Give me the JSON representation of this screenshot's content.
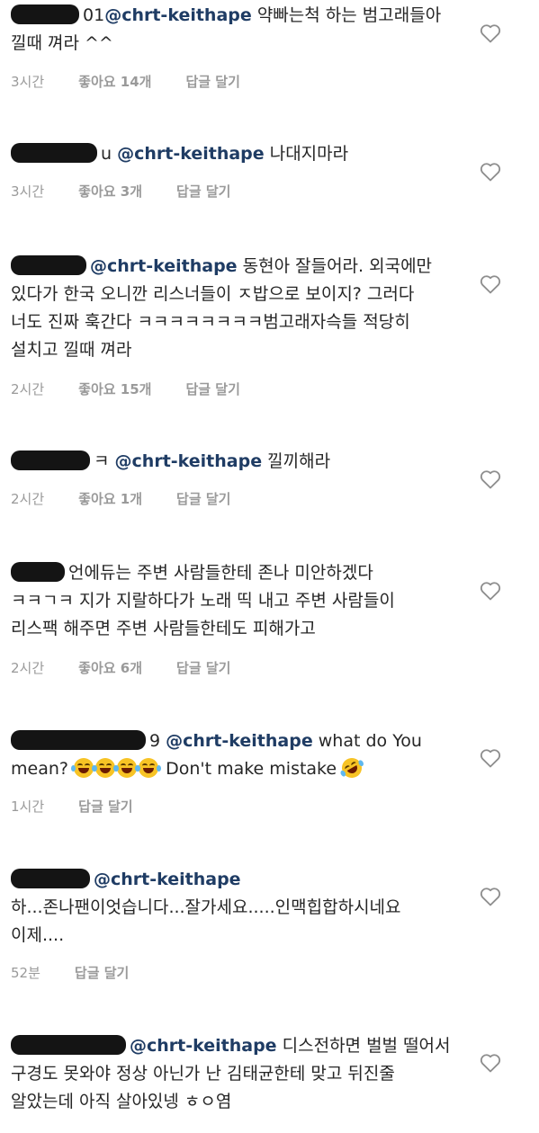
{
  "comments": [
    {
      "redacted_prefix": "01",
      "mention": "@chrt-keithape",
      "text_line1": "약빠는척 하는 범고래들아",
      "text_line2": "낄때 껴라 ^^",
      "time": "3시간",
      "likes": "좋아요 14개",
      "reply": "답글 달기"
    },
    {
      "redacted_prefix": "u",
      "mention": "@chrt-keithape",
      "text_line1": "나대지마라",
      "time": "3시간",
      "likes": "좋아요 3개",
      "reply": "답글 달기"
    },
    {
      "mention": "@chrt-keithape",
      "text_line1": "동현아 잘들어라. 외국에만",
      "text_line2": "있다가 한국 오니깐 리스너들이 ㅈ밥으로 보이지? 그러다",
      "text_line3": "너도 진짜 훅간다 ㅋㅋㅋㅋㅋㅋㅋㅋ범고래자슥들 적당히",
      "text_line4": "설치고 낄때 껴라",
      "time": "2시간",
      "likes": "좋아요 15개",
      "reply": "답글 달기"
    },
    {
      "redacted_prefix": "ㅋ",
      "mention": "@chrt-keithape",
      "text_line1": "낄끼해라",
      "time": "2시간",
      "likes": "좋아요 1개",
      "reply": "답글 달기"
    },
    {
      "text_line1": "언에듀는 주변 사람들한테 존나 미안하겠다",
      "text_line2": "ㅋㅋㄱㅋ 지가 지랄하다가 노래 띡 내고 주변 사람들이",
      "text_line3": "리스팩 해주면 주변 사람들한테도 피해가고",
      "time": "2시간",
      "likes": "좋아요 6개",
      "reply": "답글 달기"
    },
    {
      "redacted_prefix": "9",
      "mention": "@chrt-keithape",
      "text_line1": "what do You",
      "text_line2_a": "mean?",
      "text_line2_b": "Don't make mistake",
      "time": "1시간",
      "reply": "답글 달기"
    },
    {
      "mention": "@chrt-keithape",
      "text_line1": "하...존나팬이엇습니다...잘가세요.....인맥힙합하시네요",
      "text_line2": "이제....",
      "time": "52분",
      "reply": "답글 달기"
    },
    {
      "mention": "@chrt-keithape",
      "text_line1": "디스전하면 벌벌 떨어서",
      "text_line2": "구경도 못와야 정상 아닌가 난 김태균한테 맞고 뒤진줄",
      "text_line3": "알았는데 아직 살아있넹 ㅎㅇ염"
    }
  ],
  "icons": {
    "like": "heart-outline-icon",
    "emoji": "face-with-tears-of-joy-icon",
    "emoji2": "rolling-on-floor-laughing-icon"
  },
  "colors": {
    "mention": "#1f3c64",
    "meta": "#9a9a9a",
    "text": "#262626"
  }
}
